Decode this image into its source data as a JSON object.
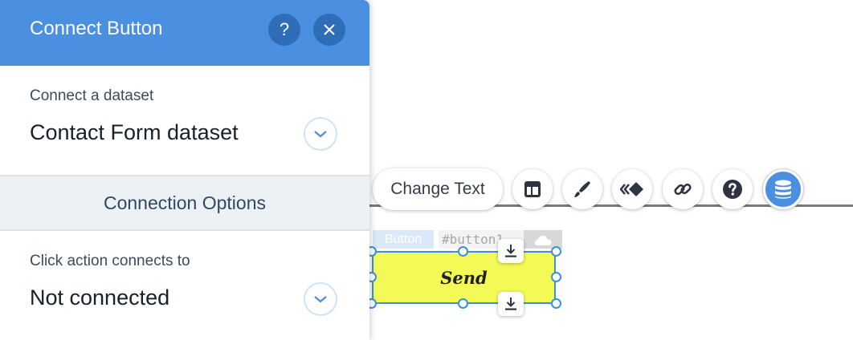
{
  "panel": {
    "title": "Connect Button",
    "help_icon": "question-icon",
    "close_icon": "close-icon",
    "dataset_label": "Connect a dataset",
    "dataset_value": "Contact Form dataset",
    "options_header": "Connection Options",
    "click_label": "Click action connects to",
    "click_value": "Not connected",
    "accent": "#4a8fe0"
  },
  "toolbar": {
    "change_text_label": "Change Text",
    "tools": [
      {
        "name": "layout-icon"
      },
      {
        "name": "design-brush-icon"
      },
      {
        "name": "animation-icon"
      },
      {
        "name": "link-icon"
      },
      {
        "name": "help-icon"
      },
      {
        "name": "database-icon",
        "active": true
      }
    ]
  },
  "element": {
    "type_tag": "Button",
    "id_tag": "#button1",
    "cloud_icon": "cloud-icon",
    "label": "Send",
    "fill_color": "#f3fa55"
  }
}
